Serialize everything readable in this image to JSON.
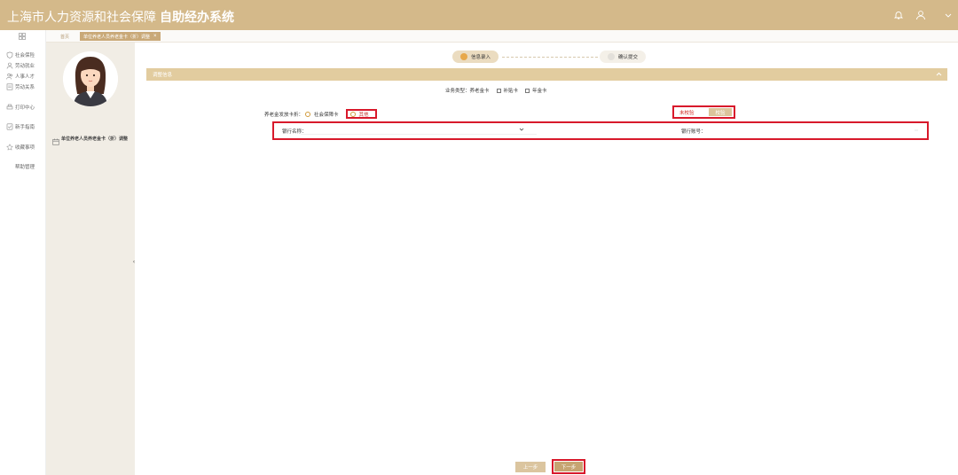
{
  "header": {
    "title": "上海市人力资源和社会保障",
    "subtitle": "自助经办系统",
    "bell_icon": "bell-icon",
    "user_icon": "user-icon",
    "menu_icon": "chevron-down-icon"
  },
  "nav": {
    "items": [
      {
        "label": "社会保险",
        "icon": "shield-icon"
      },
      {
        "label": "劳动就业",
        "icon": "person-icon"
      },
      {
        "label": "人事人才",
        "icon": "people-icon"
      },
      {
        "label": "劳动关系",
        "icon": "document-icon"
      },
      {
        "label": "打印中心",
        "icon": "printer-icon"
      },
      {
        "label": "新手指南",
        "icon": "guide-icon"
      },
      {
        "label": "收藏事项",
        "icon": "star-icon"
      },
      {
        "label": "帮助管理",
        "icon": ""
      }
    ]
  },
  "tabs": {
    "home": "首页",
    "active": "单位养老人员养老金卡（折）调整",
    "close": "×"
  },
  "profile": {
    "item": "单位养老人员养老金卡（折）调整"
  },
  "steps": {
    "step1": "信息录入",
    "step2": "确认提交"
  },
  "panel": {
    "title": "调整信息"
  },
  "form": {
    "biz_type_label": "业务类型：",
    "biz_options": [
      "养老金卡",
      "补贴卡",
      "年金卡"
    ],
    "pension_label": "养老金发放卡折：",
    "pension_social": "社会保障卡",
    "pension_other": "其他",
    "unverified": "未校验",
    "verify": "校验",
    "bank_name_label": "银行名称：",
    "bank_no_label": "银行账号："
  },
  "buttons": {
    "prev": "上一步",
    "next": "下一步"
  },
  "colors": {
    "brand": "#d4b98a",
    "accent": "#c9a978",
    "highlight": "#d8192b"
  }
}
